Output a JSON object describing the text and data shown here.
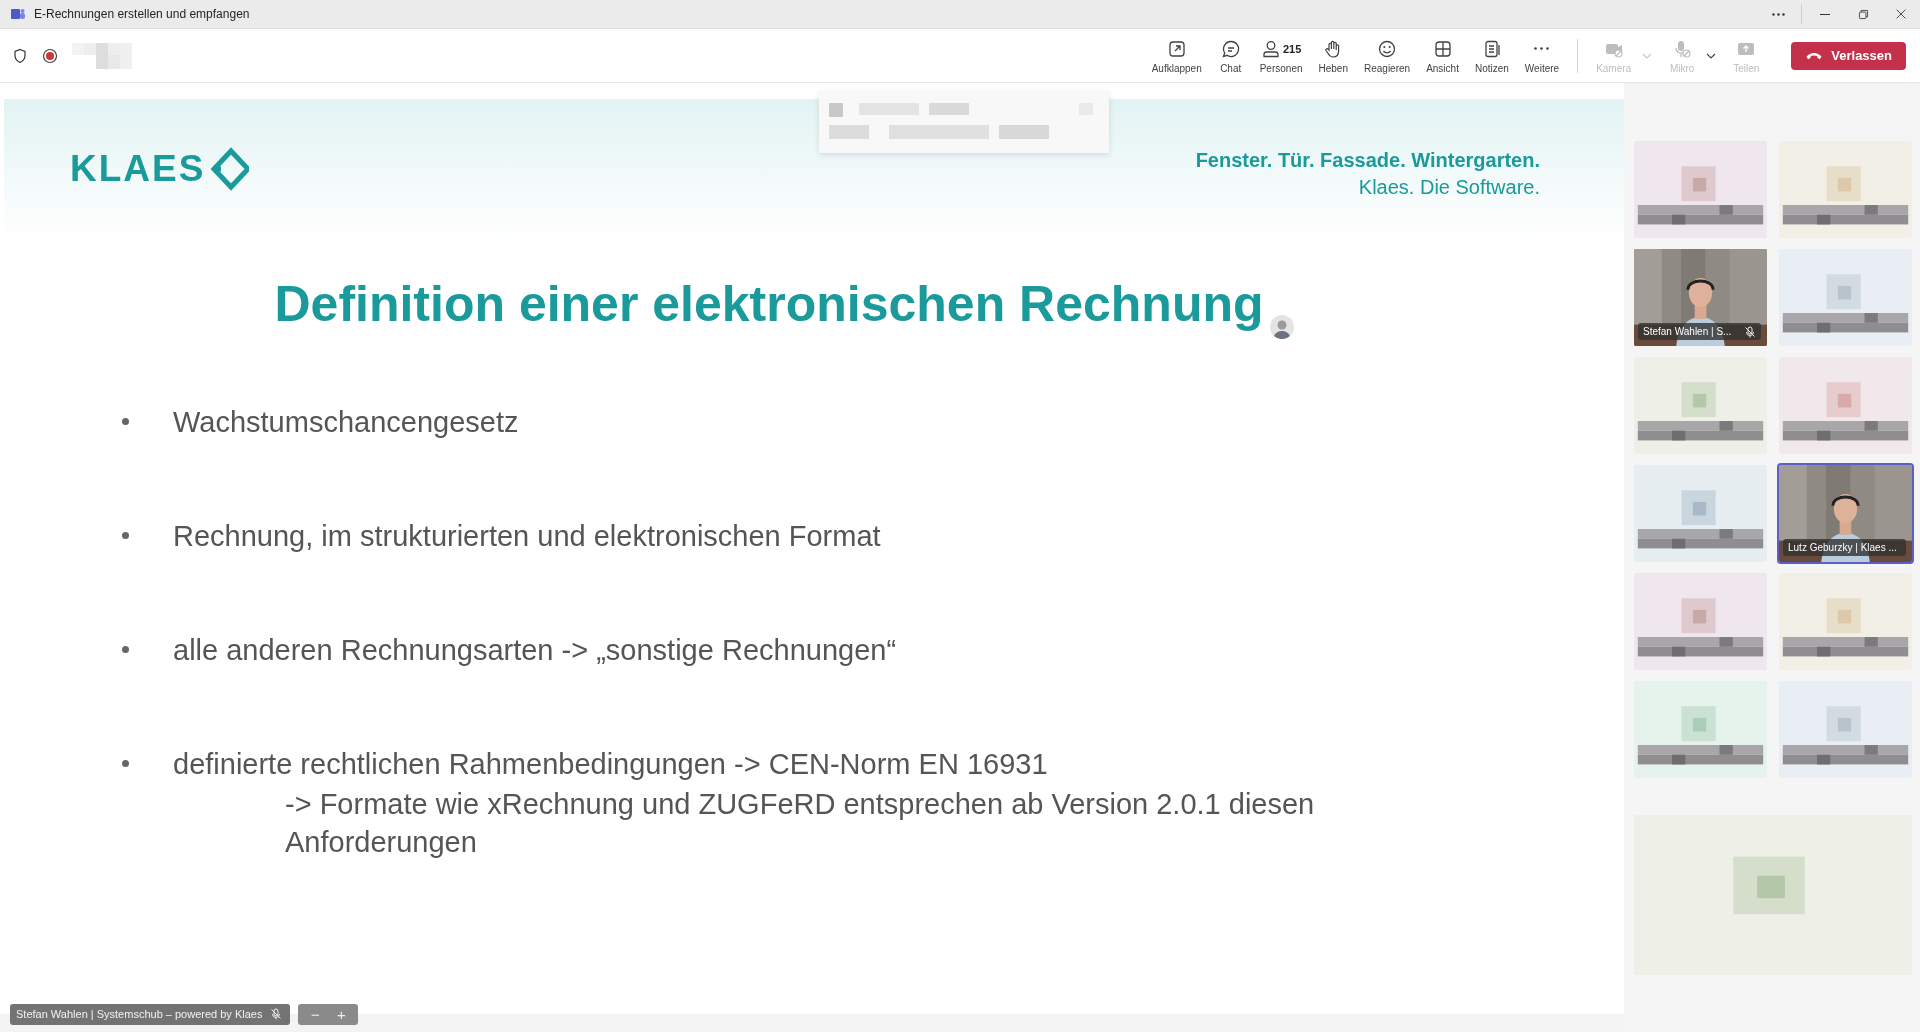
{
  "window": {
    "title": "E-Rechnungen erstellen und empfangen"
  },
  "toolbar": {
    "items": [
      {
        "label": "Aufklappen",
        "disabled": false
      },
      {
        "label": "Chat",
        "disabled": false
      },
      {
        "label": "Personen",
        "count": "215",
        "disabled": false
      },
      {
        "label": "Heben",
        "disabled": false
      },
      {
        "label": "Reagieren",
        "disabled": false
      },
      {
        "label": "Ansicht",
        "disabled": false
      },
      {
        "label": "Notizen",
        "disabled": false
      },
      {
        "label": "Weitere",
        "disabled": false
      },
      {
        "label": "Kamera",
        "disabled": true,
        "dropdown": true
      },
      {
        "label": "Mikro",
        "disabled": true,
        "dropdown": true
      },
      {
        "label": "Teilen",
        "disabled": true
      }
    ],
    "leave_button": "Verlassen"
  },
  "slide": {
    "logo": "KLAES",
    "tagline": "Fenster. Tür. Fassade. Wintergarten.",
    "subline": "Klaes. Die Software.",
    "title": "Definition einer elektronischen Rechnung",
    "bullets": [
      {
        "text": "Wachstumschancengesetz"
      },
      {
        "text": "Rechnung, im strukturierten und elektronischen Format"
      },
      {
        "text": "alle anderen Rechnungsarten -> „sonstige Rechnungen“"
      },
      {
        "text": "definierte rechtlichen Rahmenbedingungen -> CEN-Norm EN 16931",
        "continuation": "-> Formate wie xRechnung und ZUGFeRD entsprechen ab Version 2.0.1 diesen Anforderungen"
      }
    ]
  },
  "presenter_label": {
    "name": "Stefan Wahlen | Systemschub – powered by Klaes",
    "muted": true
  },
  "zoom_controls": [
    "−",
    "+"
  ],
  "participants": [
    {
      "kind": "blurred",
      "highlighted": false
    },
    {
      "kind": "blurred",
      "highlighted": false
    },
    {
      "kind": "video",
      "name": "Stefan Wahlen | S...",
      "muted": true,
      "highlighted": false
    },
    {
      "kind": "blurred",
      "highlighted": false
    },
    {
      "kind": "blurred",
      "highlighted": false
    },
    {
      "kind": "blurred",
      "highlighted": false
    },
    {
      "kind": "blurred",
      "highlighted": false
    },
    {
      "kind": "video",
      "name": "Lutz Geburzky | Klaes ...",
      "muted": false,
      "highlighted": true
    },
    {
      "kind": "blurred",
      "highlighted": false
    },
    {
      "kind": "blurred",
      "highlighted": false
    },
    {
      "kind": "blurred",
      "highlighted": false
    },
    {
      "kind": "blurred",
      "highlighted": false
    },
    {
      "kind": "blurred",
      "wide": true,
      "highlighted": false
    }
  ]
}
